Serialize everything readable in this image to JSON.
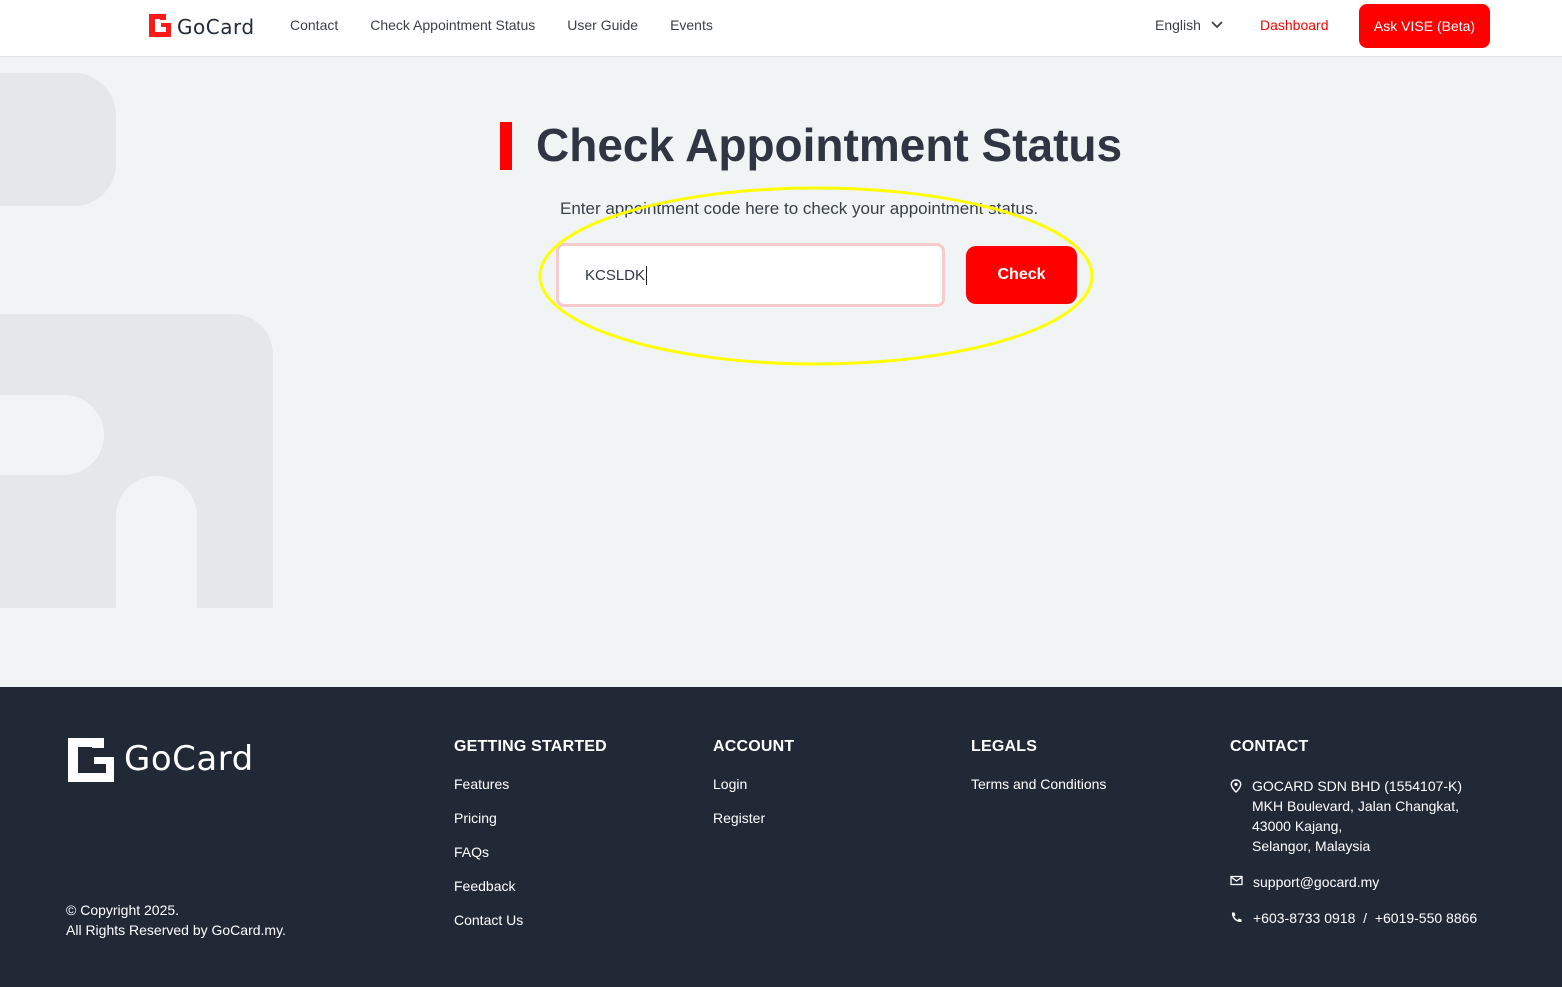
{
  "header": {
    "brand": "GoCard",
    "nav": [
      "Contact",
      "Check Appointment Status",
      "User Guide",
      "Events"
    ],
    "language": "English",
    "dashboard": "Dashboard",
    "ask_button": "Ask VISE (Beta)"
  },
  "main": {
    "title": "Check Appointment Status",
    "subtitle": "Enter appointment code here to check your appointment status.",
    "input_value": "KCSLDK",
    "check_button": "Check"
  },
  "footer": {
    "brand": "GoCard",
    "copyright_line1": "© Copyright 2025.",
    "copyright_line2": "All Rights Reserved by GoCard.my.",
    "getting_started": {
      "heading": "GETTING STARTED",
      "links": [
        "Features",
        "Pricing",
        "FAQs",
        "Feedback",
        "Contact Us"
      ]
    },
    "account": {
      "heading": "ACCOUNT",
      "links": [
        "Login",
        "Register"
      ]
    },
    "legals": {
      "heading": "LEGALS",
      "links": [
        "Terms and Conditions"
      ]
    },
    "contact": {
      "heading": "CONTACT",
      "address": [
        "GOCARD SDN BHD (1554107-K)",
        "MKH Boulevard, Jalan Changkat,",
        "43000 Kajang,",
        "Selangor, Malaysia"
      ],
      "email": "support@gocard.my",
      "phone": "+603-8733 0918  /  +6019-550 8866"
    }
  },
  "colors": {
    "accent": "#ff0000",
    "footer_bg": "#212936",
    "highlight": "#ffff00"
  },
  "icons": [
    "location-pin-icon",
    "mail-icon",
    "phone-icon",
    "chevron-down-icon"
  ]
}
